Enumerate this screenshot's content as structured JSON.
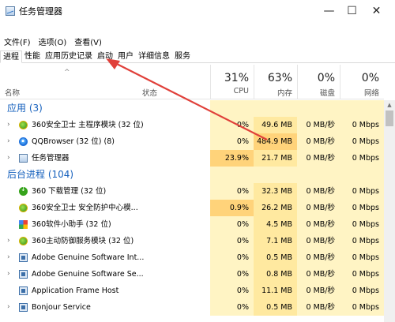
{
  "window": {
    "title": "任务管理器"
  },
  "menu": [
    "文件(F)",
    "选项(O)",
    "查看(V)"
  ],
  "tabs": [
    "进程",
    "性能",
    "应用历史记录",
    "启动",
    "用户",
    "详细信息",
    "服务"
  ],
  "active_tab": 0,
  "columns": {
    "name": "名称",
    "status": "状态",
    "cpu": {
      "pct": "31%",
      "label": "CPU"
    },
    "mem": {
      "pct": "63%",
      "label": "内存"
    },
    "disk": {
      "pct": "0%",
      "label": "磁盘"
    },
    "net": {
      "pct": "0%",
      "label": "网络"
    }
  },
  "groups": {
    "apps": "应用 (3)",
    "background": "后台进程 (104)"
  },
  "processes": [
    {
      "name": "360安全卫士 主程序模块 (32 位)",
      "cpu": "0%",
      "mem": "49.6 MB",
      "disk": "0 MB/秒",
      "net": "0 Mbps",
      "icon": "360-icon",
      "expand": true
    },
    {
      "name": "QQBrowser (32 位) (8)",
      "cpu": "0%",
      "mem": "484.9 MB",
      "disk": "0 MB/秒",
      "net": "0 Mbps",
      "icon": "qqbrowser-icon",
      "expand": true
    },
    {
      "name": "任务管理器",
      "cpu": "23.9%",
      "mem": "21.7 MB",
      "disk": "0 MB/秒",
      "net": "0 Mbps",
      "icon": "task-manager-icon",
      "expand": true
    },
    {
      "name": "360 下载管理 (32 位)",
      "cpu": "0%",
      "mem": "32.3 MB",
      "disk": "0 MB/秒",
      "net": "0 Mbps",
      "icon": "download-icon",
      "expand": false
    },
    {
      "name": "360安全卫士 安全防护中心模...",
      "cpu": "0.9%",
      "mem": "26.2 MB",
      "disk": "0 MB/秒",
      "net": "0 Mbps",
      "icon": "360-icon",
      "expand": false
    },
    {
      "name": "360软件小助手 (32 位)",
      "cpu": "0%",
      "mem": "4.5 MB",
      "disk": "0 MB/秒",
      "net": "0 Mbps",
      "icon": "grid-icon",
      "expand": false
    },
    {
      "name": "360主动防御服务模块 (32 位)",
      "cpu": "0%",
      "mem": "7.1 MB",
      "disk": "0 MB/秒",
      "net": "0 Mbps",
      "icon": "360-icon",
      "expand": true
    },
    {
      "name": "Adobe Genuine Software Int...",
      "cpu": "0%",
      "mem": "0.5 MB",
      "disk": "0 MB/秒",
      "net": "0 Mbps",
      "icon": "service-icon",
      "expand": true
    },
    {
      "name": "Adobe Genuine Software Se...",
      "cpu": "0%",
      "mem": "0.8 MB",
      "disk": "0 MB/秒",
      "net": "0 Mbps",
      "icon": "service-icon",
      "expand": true
    },
    {
      "name": "Application Frame Host",
      "cpu": "0%",
      "mem": "11.1 MB",
      "disk": "0 MB/秒",
      "net": "0 Mbps",
      "icon": "service-icon",
      "expand": false
    },
    {
      "name": "Bonjour Service",
      "cpu": "0%",
      "mem": "0.5 MB",
      "disk": "0 MB/秒",
      "net": "0 Mbps",
      "icon": "service-icon",
      "expand": true
    }
  ],
  "colors": {
    "heat_light": "#fff4c4",
    "heat_mid": "#ffe9a0",
    "heat_strong": "#ffd37a",
    "group_text": "#1560bd",
    "arrow": "#e0403a"
  }
}
